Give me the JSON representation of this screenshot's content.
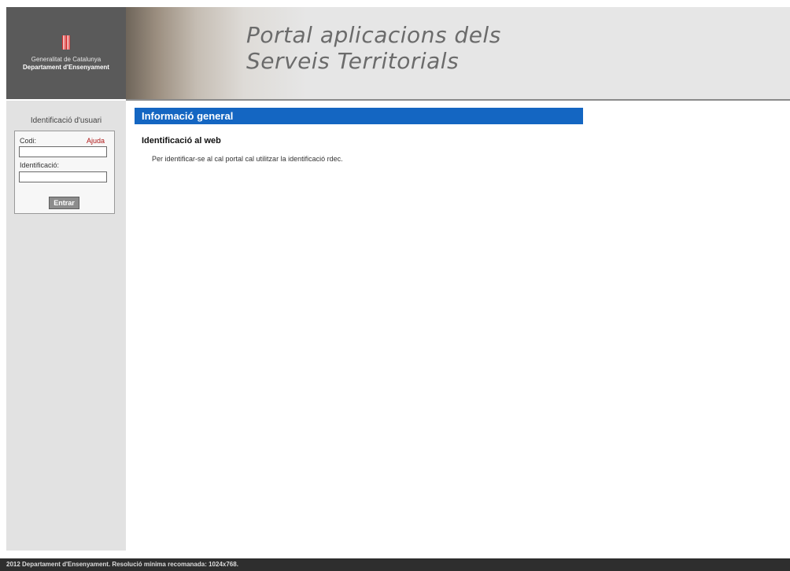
{
  "header": {
    "logo": {
      "emblem_icon": "catalan-flag-icon",
      "line1": "Generalitat de Catalunya",
      "line2": "Departament d'Ensenyament"
    },
    "title_line1": "Portal aplicacions dels",
    "title_line2": "Serveis Territorials"
  },
  "sidebar": {
    "login": {
      "title": "Identificació d'usuari",
      "code_label": "Codi:",
      "help_link": "Ajuda",
      "code_value": "",
      "id_label": "Identificació:",
      "id_value": "",
      "submit_label": "Entrar"
    }
  },
  "main": {
    "section_title": "Informació general",
    "subheading": "Identificació al web",
    "text": "Per identificar-se al cal portal cal utilitzar la identificació rdec."
  },
  "footer": {
    "text": "2012 Departament d'Ensenyament. Resolució mínima recomanada: 1024x768."
  },
  "colors": {
    "section_bar": "#1466c2",
    "help_link": "#b01818",
    "footer_bg": "#2e2e2e"
  }
}
